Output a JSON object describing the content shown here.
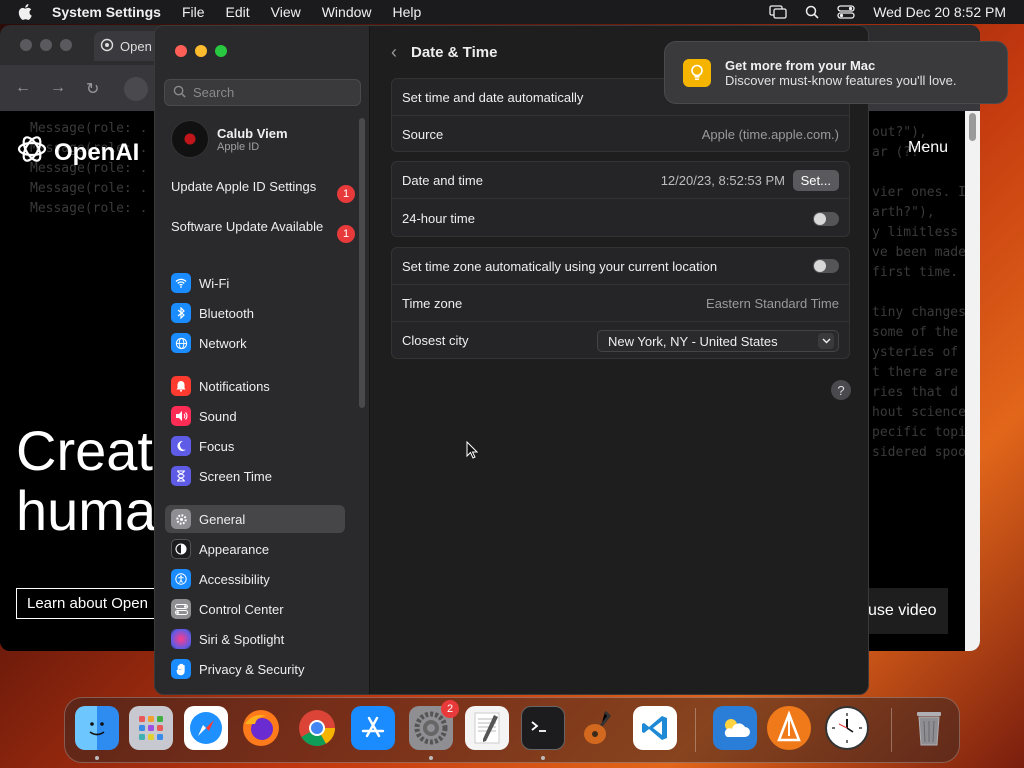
{
  "menubar": {
    "app_name": "System Settings",
    "menus": [
      "File",
      "Edit",
      "View",
      "Window",
      "Help"
    ],
    "datetime": "Wed Dec 20  8:52 PM"
  },
  "browser": {
    "tab_label": "Open",
    "logo_text": "OpenAI",
    "menu_link": "Menu",
    "hero_line1": "Creati",
    "hero_line2": "huma",
    "learn_button": "Learn about Open",
    "pause_button": "use video",
    "code_lines": [
      "Message(role: .",
      "Message(role: .",
      "Message(role: .",
      "Message(role: .",
      "Message(role: ."
    ],
    "code_right": [
      "out?\"),",
      "ar (??\"",
      "vier ones. I",
      "arth?\"),",
      "y limitless",
      "ve been made",
      "first time.",
      "tiny changes",
      "some of the",
      "ysteries of",
      "t there are",
      "ries that d",
      "hout science",
      "pecific topi",
      "sidered spoo"
    ]
  },
  "sidebar": {
    "search_placeholder": "Search",
    "user_name": "Calub Viem",
    "user_sub": "Apple ID",
    "notices": [
      {
        "label": "Update Apple ID Settings",
        "badge": "1"
      },
      {
        "label": "Software Update Available",
        "badge": "1"
      }
    ],
    "items": [
      {
        "label": "Wi-Fi",
        "icon": "wifi-icon",
        "color": "#1a8cff"
      },
      {
        "label": "Bluetooth",
        "icon": "bluetooth-icon",
        "color": "#1a8cff"
      },
      {
        "label": "Network",
        "icon": "globe-icon",
        "color": "#1a8cff"
      },
      {
        "label": "Notifications",
        "icon": "bell-icon",
        "color": "#ff3b30"
      },
      {
        "label": "Sound",
        "icon": "speaker-icon",
        "color": "#ff2d55"
      },
      {
        "label": "Focus",
        "icon": "moon-icon",
        "color": "#5e5ce6"
      },
      {
        "label": "Screen Time",
        "icon": "hourglass-icon",
        "color": "#5e5ce6"
      },
      {
        "label": "General",
        "icon": "gear-icon",
        "color": "#8e8e93"
      },
      {
        "label": "Appearance",
        "icon": "appearance-icon",
        "color": "#1c1c1e"
      },
      {
        "label": "Accessibility",
        "icon": "accessibility-icon",
        "color": "#1a8cff"
      },
      {
        "label": "Control Center",
        "icon": "control-center-icon",
        "color": "#8e8e93"
      },
      {
        "label": "Siri & Spotlight",
        "icon": "siri-icon",
        "color": "#bf5af2"
      },
      {
        "label": "Privacy & Security",
        "icon": "hand-icon",
        "color": "#1a8cff"
      }
    ],
    "active": "General"
  },
  "main": {
    "title": "Date & Time",
    "rows": {
      "auto_time": "Set time and date automatically",
      "source_label": "Source",
      "source_value": "Apple (time.apple.com.)",
      "date_time_label": "Date and time",
      "date_time_value": "12/20/23, 8:52:53 PM",
      "set_button": "Set...",
      "hour24_label": "24-hour time",
      "auto_tz_label": "Set time zone automatically using your current location",
      "tz_label": "Time zone",
      "tz_value": "Eastern Standard Time",
      "city_label": "Closest city",
      "city_value": "New York, NY - United States"
    },
    "help": "?"
  },
  "notification": {
    "title": "Get more from your Mac",
    "body": "Discover must-know features you'll love."
  },
  "dock": {
    "apps": [
      {
        "name": "finder-icon",
        "color": "#2e8bf0"
      },
      {
        "name": "launchpad-icon",
        "color": "#d0d0d8"
      },
      {
        "name": "safari-icon",
        "color": "#1e90ff"
      },
      {
        "name": "firefox-icon",
        "color": "#ff7a1a"
      },
      {
        "name": "chrome-icon",
        "color": "#ffffff"
      },
      {
        "name": "app-store-icon",
        "color": "#1a8cff"
      },
      {
        "name": "system-settings-icon",
        "color": "#8e8e93",
        "badge": "2"
      },
      {
        "name": "textedit-icon",
        "color": "#f4f4f4"
      },
      {
        "name": "terminal-icon",
        "color": "#1c1c1e"
      },
      {
        "name": "garageband-icon",
        "color": "#3a2a1a"
      },
      {
        "name": "vscode-icon",
        "color": "#ffffff"
      },
      {
        "name": "weather-icon",
        "color": "#2a7ed8"
      },
      {
        "name": "pages-icon",
        "color": "#f07a1a"
      },
      {
        "name": "clock-icon",
        "color": "#ffffff"
      },
      {
        "name": "trash-icon",
        "color": "#9a9a9e"
      }
    ]
  }
}
